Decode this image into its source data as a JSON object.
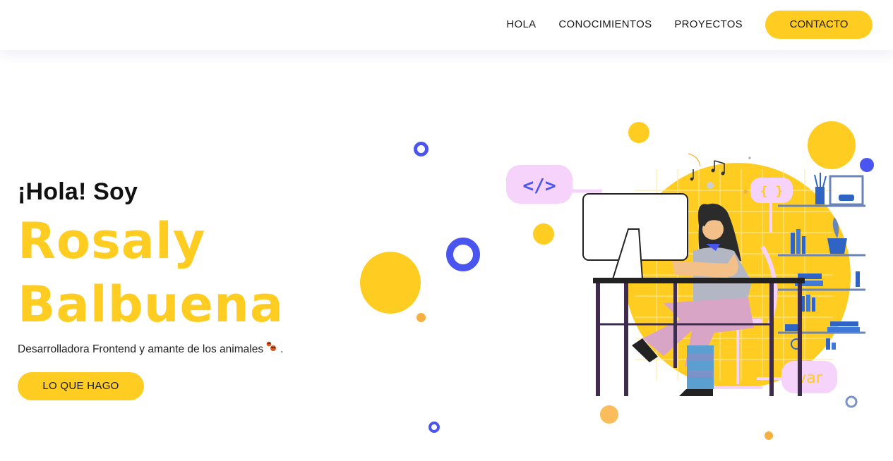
{
  "nav": {
    "links": [
      "HOLA",
      "CONOCIMIENTOS",
      "PROYECTOS"
    ],
    "cta_label": "CONTACTO"
  },
  "hero": {
    "greeting": "¡Hola! Soy",
    "name_line1": "Rosaly",
    "name_line2": "Balbuena",
    "subtitle": "Desarrolladora Frontend y amante de los animales",
    "subtitle_end": ".",
    "cta_label": "LO QUE HAGO"
  },
  "illustration": {
    "code_tag": "</>",
    "braces_tag": "{ }",
    "var_tag": "var"
  },
  "colors": {
    "accent": "#ffcd22",
    "blue": "#4a55f0",
    "pink": "#f5d3fb"
  }
}
